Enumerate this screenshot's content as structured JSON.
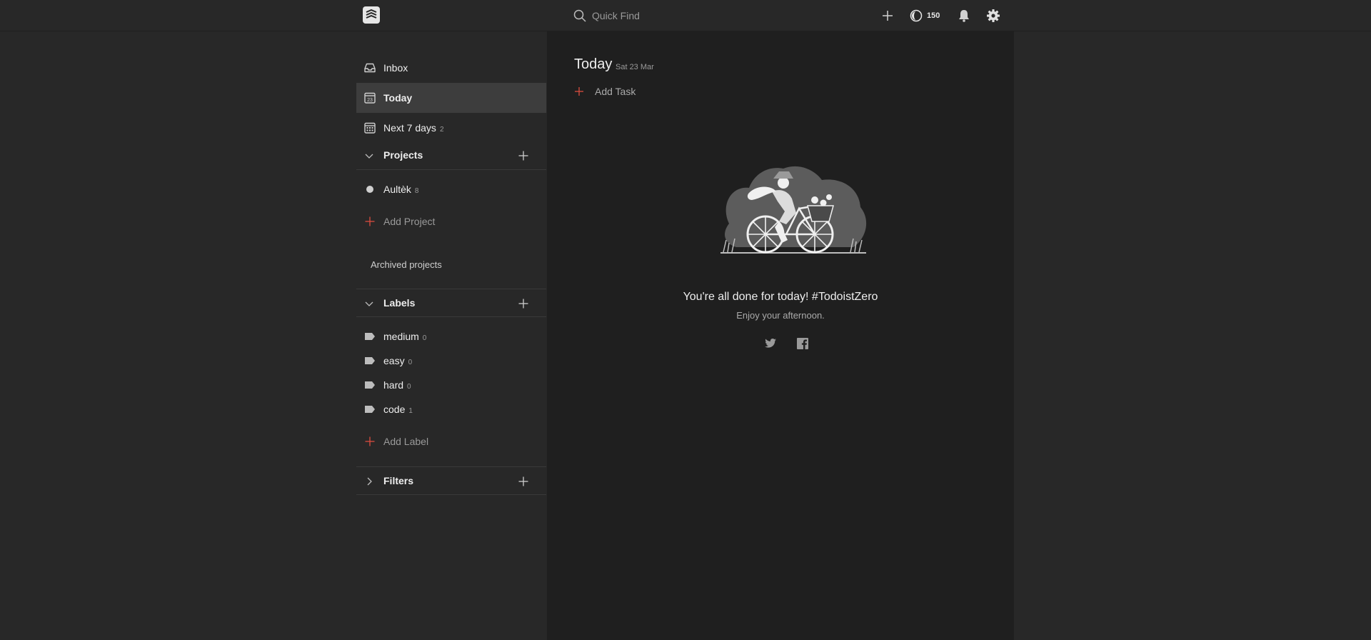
{
  "topbar": {
    "search_placeholder": "Quick Find",
    "karma_points": "150"
  },
  "sidebar": {
    "nav": {
      "inbox": "Inbox",
      "today": "Today",
      "next7": "Next 7 days",
      "next7_count": "2"
    },
    "projects": {
      "title": "Projects",
      "items": [
        {
          "label": "Aultèk",
          "count": "8"
        }
      ],
      "add_label": "Add Project",
      "archived_label": "Archived projects"
    },
    "labels": {
      "title": "Labels",
      "items": [
        {
          "label": "medium",
          "count": "0"
        },
        {
          "label": "easy",
          "count": "0"
        },
        {
          "label": "hard",
          "count": "0"
        },
        {
          "label": "code",
          "count": "1"
        }
      ],
      "add_label": "Add Label"
    },
    "filters": {
      "title": "Filters"
    }
  },
  "main": {
    "title": "Today",
    "date": "Sat 23 Mar",
    "add_task": "Add Task",
    "empty_title": "You're all done for today! #TodoistZero",
    "empty_subtitle": "Enjoy your afternoon."
  },
  "icons": {
    "logo": "todoist-logo-icon",
    "search": "search-icon",
    "add": "plus-icon",
    "karma": "karma-icon",
    "bell": "bell-icon",
    "gear": "gear-icon",
    "twitter": "twitter-icon",
    "facebook": "facebook-icon"
  },
  "colors": {
    "accent": "#db4c3f",
    "background": "#282828",
    "main_bg": "#1f1f1f",
    "active_item": "#3d3d3d"
  }
}
